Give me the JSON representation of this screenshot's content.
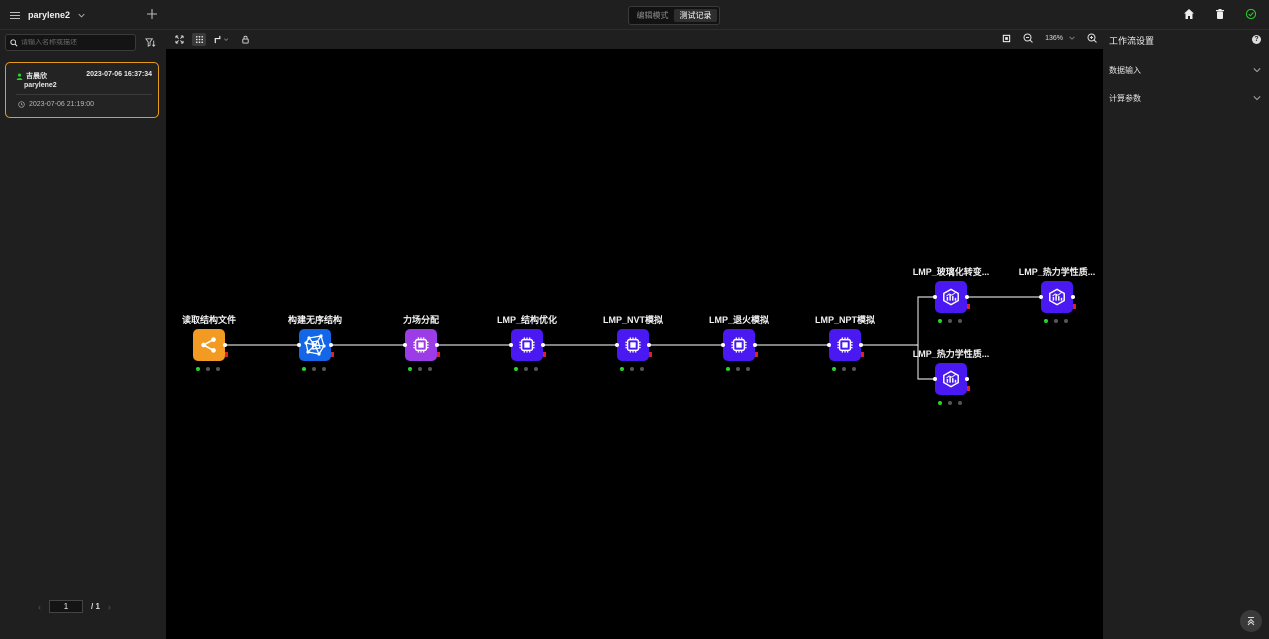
{
  "topbar": {
    "project_name": "parylene2",
    "modes": [
      {
        "label": "编辑模式",
        "active": false
      },
      {
        "label": "测试记录",
        "active": true
      }
    ]
  },
  "left_panel": {
    "search_placeholder": "请输入名称或描述",
    "record": {
      "user": "吉晨欣",
      "timestamp": "2023-07-06 16:37:34",
      "project": "parylene2",
      "created": "2023-07-06 21:19:00"
    },
    "pagination": {
      "current": "1",
      "total": "/ 1"
    }
  },
  "canvas_toolbar": {
    "zoom": "136%"
  },
  "nodes": [
    {
      "label": "读取结构文件",
      "color": "#f39a22",
      "icon": "share-icon"
    },
    {
      "label": "构建无序结构",
      "color": "#1366e8",
      "icon": "network-icon"
    },
    {
      "label": "力场分配",
      "color": "#9b3ce6",
      "icon": "chip-icon"
    },
    {
      "label": "LMP_结构优化",
      "color": "#4a19f2",
      "icon": "chip-icon"
    },
    {
      "label": "LMP_NVT模拟",
      "color": "#4a19f2",
      "icon": "chip-icon"
    },
    {
      "label": "LMP_退火模拟",
      "color": "#4a19f2",
      "icon": "chip-icon"
    },
    {
      "label": "LMP_NPT模拟",
      "color": "#4a19f2",
      "icon": "chip-icon"
    },
    {
      "label": "LMP_玻璃化转变...",
      "color": "#4a19f2",
      "icon": "chart-icon"
    },
    {
      "label": "LMP_热力学性质...",
      "color": "#4a19f2",
      "icon": "chart-icon"
    },
    {
      "label": "LMP_热力学性质...",
      "color": "#4a19f2",
      "icon": "chart-icon"
    }
  ],
  "right_panel": {
    "title": "工作流设置",
    "sections": [
      "数据输入",
      "计算参数"
    ]
  },
  "colors": {
    "accent_border": "#e89b1a",
    "status_ok": "#29d429",
    "status_error": "#e02020"
  }
}
